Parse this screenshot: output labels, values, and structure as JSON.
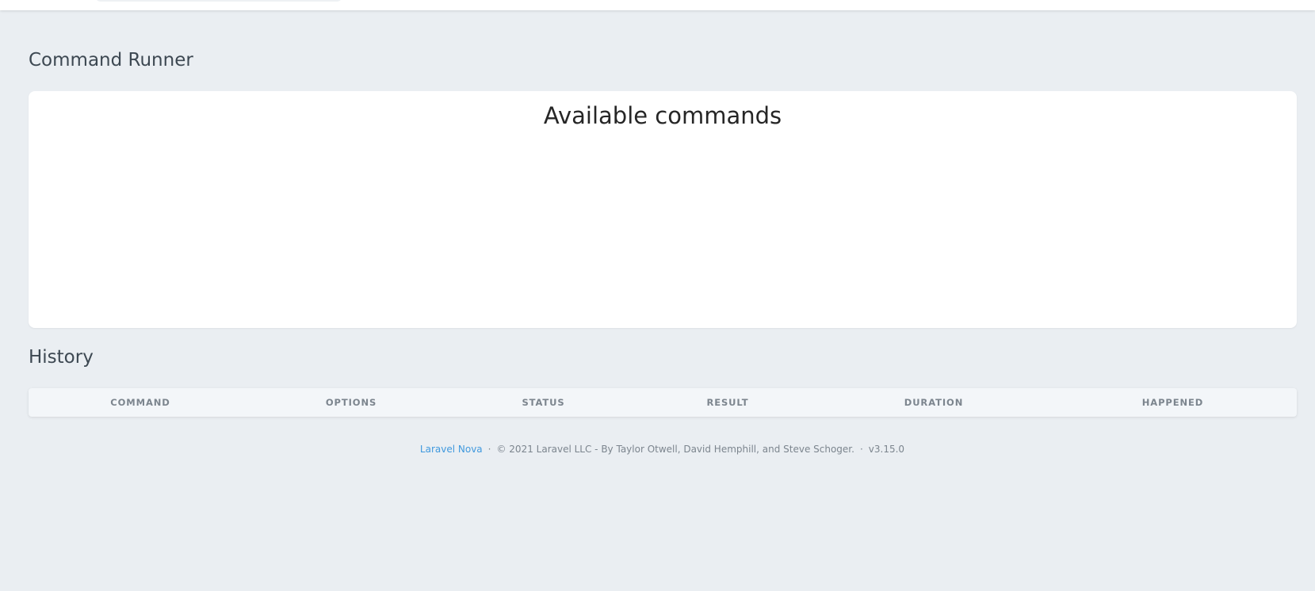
{
  "page": {
    "title": "Command Runner"
  },
  "commands": {
    "heading": "Available commands"
  },
  "history": {
    "title": "History",
    "columns": [
      "COMMAND",
      "OPTIONS",
      "STATUS",
      "RESULT",
      "DURATION",
      "HAPPENED"
    ]
  },
  "footer": {
    "link_text": "Laravel Nova",
    "separator": "·",
    "copyright": "© 2021 Laravel LLC - By Taylor Otwell, David Hemphill, and Steve Schoger.",
    "version": "v3.15.0"
  },
  "colors": {
    "background": "#eaeef2",
    "card": "#ffffff",
    "link": "#4099de",
    "muted_text": "#7c858e"
  }
}
